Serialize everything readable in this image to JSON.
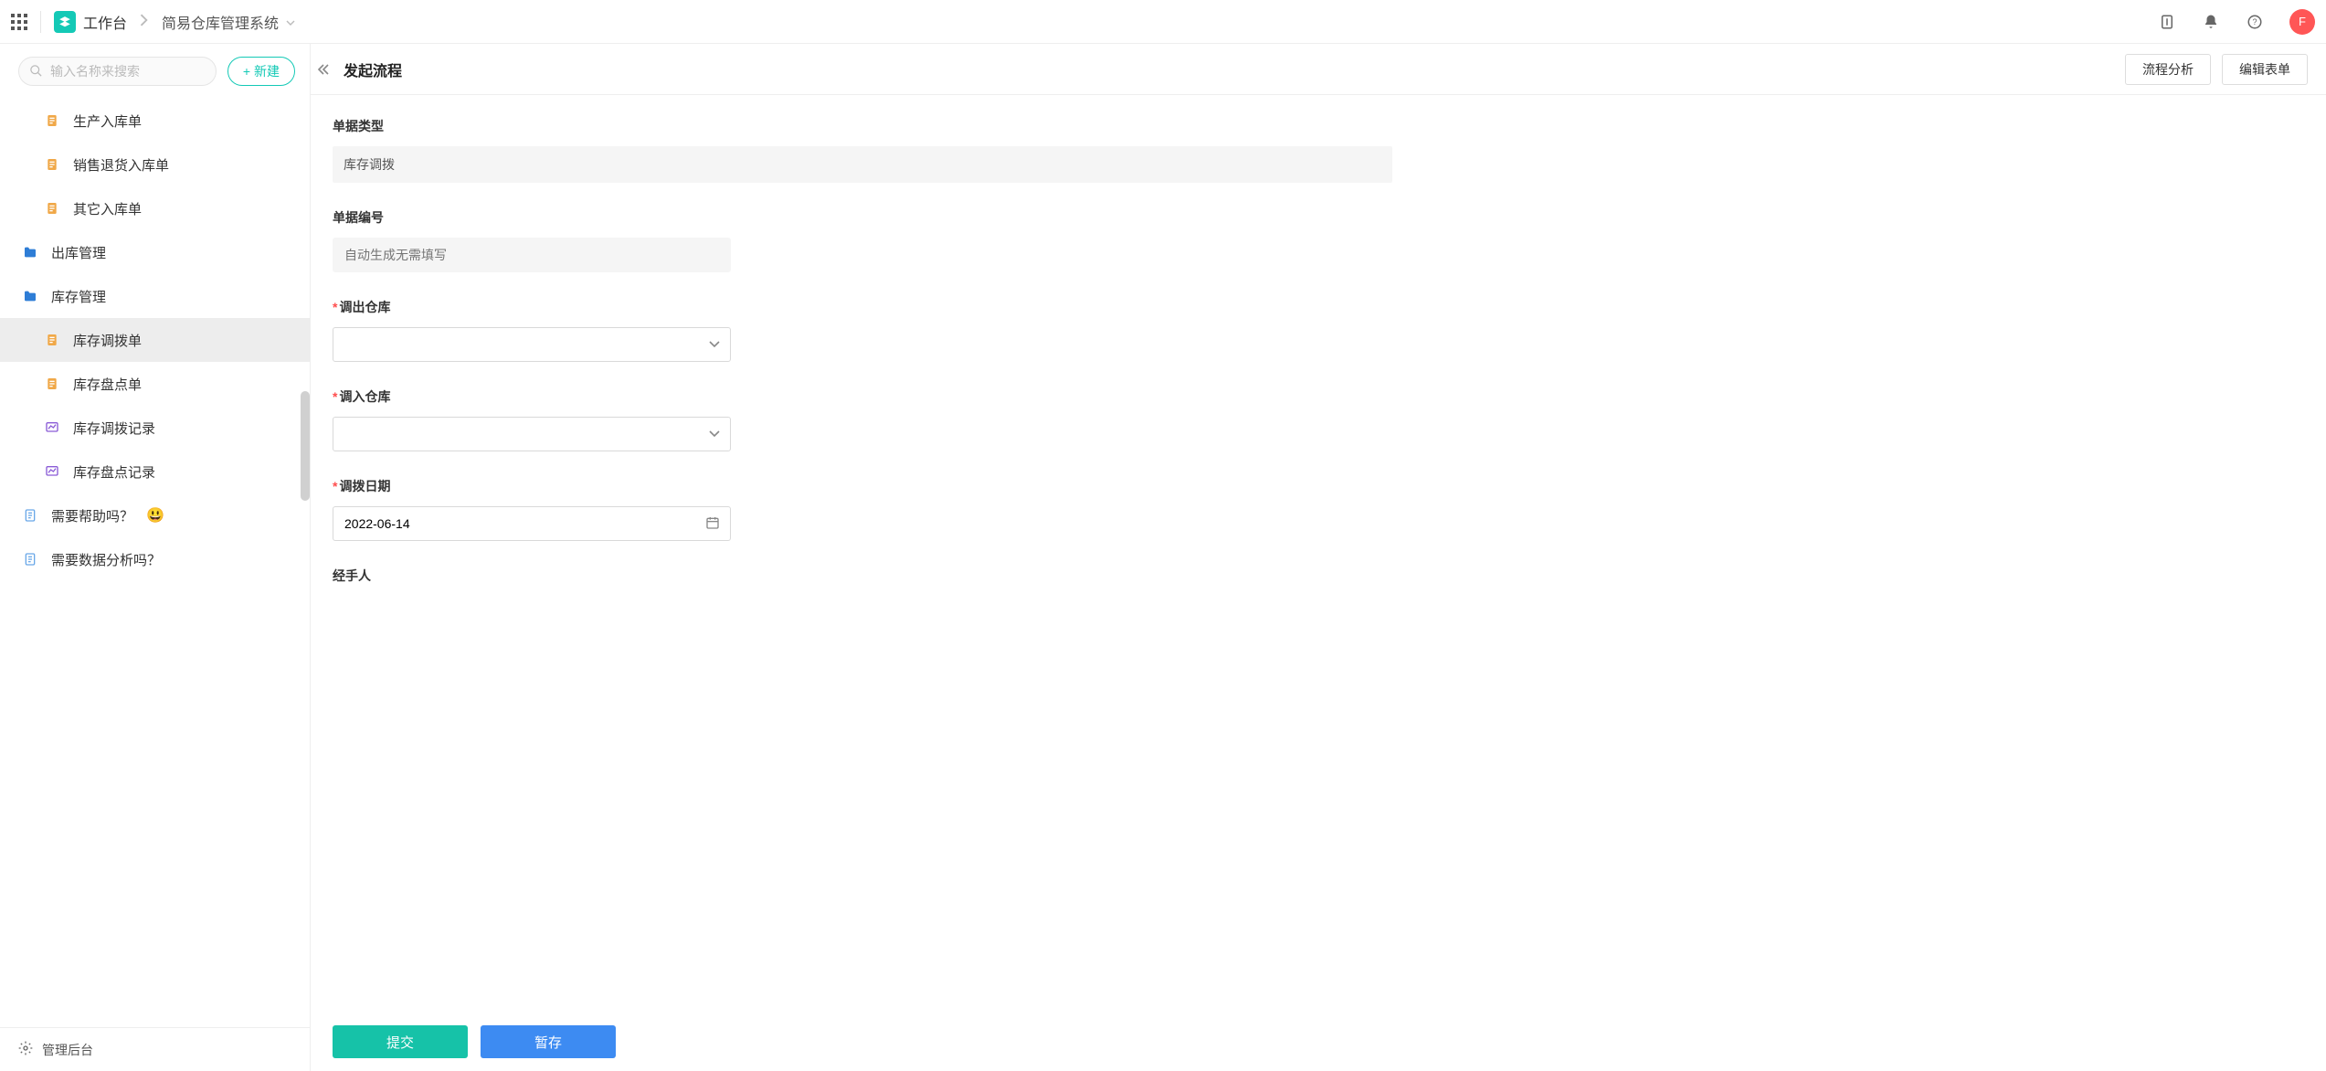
{
  "topbar": {
    "workbench": "工作台",
    "app_name": "简易仓库管理系统",
    "avatar_letter": "F"
  },
  "sidebar": {
    "search_placeholder": "输入名称来搜索",
    "new_button": "新建",
    "items": [
      {
        "label": "生产入库单",
        "icon": "doc"
      },
      {
        "label": "销售退货入库单",
        "icon": "doc"
      },
      {
        "label": "其它入库单",
        "icon": "doc"
      },
      {
        "label": "出库管理",
        "icon": "folder",
        "level": 1
      },
      {
        "label": "库存管理",
        "icon": "folder",
        "level": 1
      },
      {
        "label": "库存调拨单",
        "icon": "doc",
        "active": true
      },
      {
        "label": "库存盘点单",
        "icon": "doc"
      },
      {
        "label": "库存调拨记录",
        "icon": "chart"
      },
      {
        "label": "库存盘点记录",
        "icon": "chart"
      },
      {
        "label": "需要帮助吗？",
        "icon": "page",
        "level": 1,
        "emoji": "😃"
      },
      {
        "label": "需要数据分析吗？",
        "icon": "page",
        "level": 1
      }
    ],
    "footer": "管理后台"
  },
  "header": {
    "title": "发起流程",
    "analyze_btn": "流程分析",
    "edit_btn": "编辑表单"
  },
  "form": {
    "doc_type_label": "单据类型",
    "doc_type_value": "库存调拨",
    "doc_no_label": "单据编号",
    "doc_no_placeholder": "自动生成无需填写",
    "out_wh_label": "调出仓库",
    "in_wh_label": "调入仓库",
    "date_label": "调拨日期",
    "date_value": "2022-06-14",
    "handler_label": "经手人"
  },
  "footer": {
    "submit": "提交",
    "save": "暂存"
  }
}
